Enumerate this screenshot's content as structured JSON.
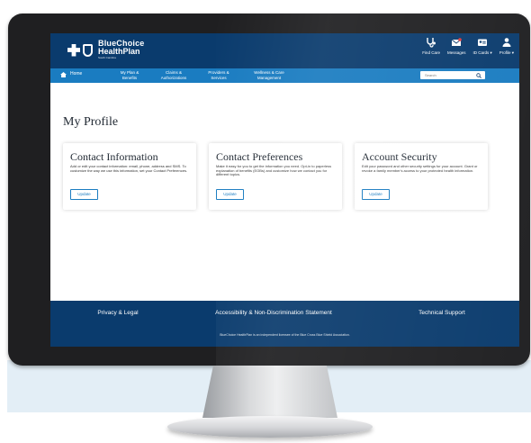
{
  "logo": {
    "line1": "BlueChoice",
    "line2": "HealthPlan",
    "line3": "South Carolina"
  },
  "top_nav": [
    {
      "label": "Find Care",
      "icon": "stethoscope-icon"
    },
    {
      "label": "Messages",
      "icon": "envelope-icon"
    },
    {
      "label": "ID Cards ▾",
      "icon": "id-card-icon"
    },
    {
      "label": "Profile ▾",
      "icon": "person-icon"
    }
  ],
  "main_nav": [
    {
      "label": "Home",
      "icon": "home-icon"
    },
    {
      "label": "My Plan & Benefits"
    },
    {
      "label": "Claims & Authorizations"
    },
    {
      "label": "Providers & Services"
    },
    {
      "label": "Wellness & Care Management"
    }
  ],
  "search": {
    "placeholder": "Search",
    "icon": "search-icon"
  },
  "page_title": "My Profile",
  "cards": [
    {
      "title": "Contact Information",
      "description": "Add or edit your contact information: email, phone, address and SMS. To customize the way we use this information, set your Contact Preferences.",
      "button": "Update"
    },
    {
      "title": "Contact Preferences",
      "description": "Make it easy for you to get the information you need. Opt-in to paperless explanation of benefits (EOBs) and customize how we contact you for different topics.",
      "button": "Update"
    },
    {
      "title": "Account Security",
      "description": "Edit your password and other security settings for your account. Grant or revoke a family member's access to your protected health information.",
      "button": "Update"
    }
  ],
  "footer": {
    "links": [
      "Privacy & Legal",
      "Accessibility & Non-Discrimination Statement",
      "Technical Support"
    ],
    "note": "BlueChoice HealthPlan is an independent licensee of the Blue Cross Blue Shield Association."
  },
  "colors": {
    "header_navy": "#0a3b6d",
    "nav_blue": "#1a7cc1",
    "monitor_bezel": "#1f1f21"
  }
}
